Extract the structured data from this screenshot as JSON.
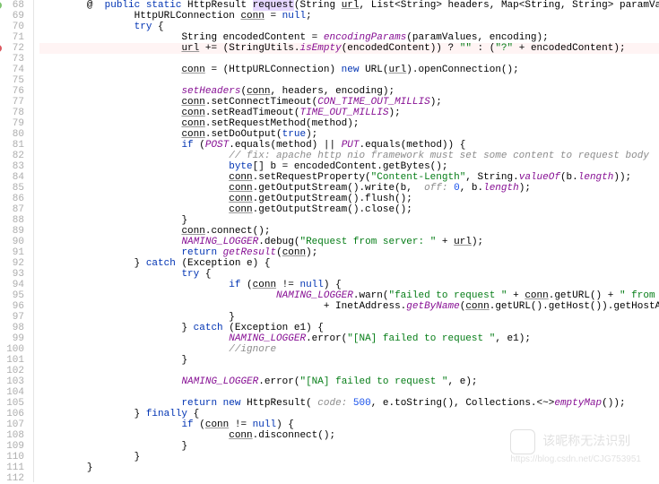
{
  "gutter": {
    "start": 68,
    "end": 112,
    "markers": {
      "68": "green",
      "72": "red"
    },
    "at_marker_line": 68
  },
  "code": {
    "lines": [
      {
        "n": 68,
        "indent": 2,
        "tokens": [
          {
            "t": "@  ",
            "c": ""
          },
          {
            "t": "public static ",
            "c": "kw"
          },
          {
            "t": "HttpResult ",
            "c": "type"
          },
          {
            "t": "request",
            "c": "hl-bg"
          },
          {
            "t": "(String ",
            "c": ""
          },
          {
            "t": "url",
            "c": "underline"
          },
          {
            "t": ", List<String> headers, Map<String, String> paramValues, String encoding, String method) {",
            "c": ""
          }
        ]
      },
      {
        "n": 69,
        "indent": 4,
        "tokens": [
          {
            "t": "HttpURLConnection ",
            "c": ""
          },
          {
            "t": "conn",
            "c": "underline"
          },
          {
            "t": " = ",
            "c": ""
          },
          {
            "t": "null",
            "c": "kw"
          },
          {
            "t": ";",
            "c": ""
          }
        ]
      },
      {
        "n": 70,
        "indent": 4,
        "tokens": [
          {
            "t": "try ",
            "c": "kw"
          },
          {
            "t": "{",
            "c": ""
          }
        ]
      },
      {
        "n": 71,
        "indent": 6,
        "tokens": [
          {
            "t": "String encodedContent = ",
            "c": ""
          },
          {
            "t": "encodingParams",
            "c": "field"
          },
          {
            "t": "(paramValues, encoding);",
            "c": ""
          }
        ]
      },
      {
        "n": 72,
        "indent": 6,
        "hl": true,
        "tokens": [
          {
            "t": "url",
            "c": "underline"
          },
          {
            "t": " += (StringUtils.",
            "c": ""
          },
          {
            "t": "isEmpty",
            "c": "field"
          },
          {
            "t": "(encodedContent)) ? ",
            "c": ""
          },
          {
            "t": "\"\"",
            "c": "str"
          },
          {
            "t": " : (",
            "c": ""
          },
          {
            "t": "\"?\"",
            "c": "str"
          },
          {
            "t": " + encodedContent);",
            "c": ""
          }
        ]
      },
      {
        "n": 73,
        "indent": 0,
        "tokens": []
      },
      {
        "n": 74,
        "indent": 6,
        "tokens": [
          {
            "t": "conn",
            "c": "underline"
          },
          {
            "t": " = (HttpURLConnection) ",
            "c": ""
          },
          {
            "t": "new ",
            "c": "kw"
          },
          {
            "t": "URL(",
            "c": ""
          },
          {
            "t": "url",
            "c": "underline"
          },
          {
            "t": ").openConnection();",
            "c": ""
          }
        ]
      },
      {
        "n": 75,
        "indent": 0,
        "tokens": []
      },
      {
        "n": 76,
        "indent": 6,
        "tokens": [
          {
            "t": "setHeaders",
            "c": "field"
          },
          {
            "t": "(",
            "c": ""
          },
          {
            "t": "conn",
            "c": "underline"
          },
          {
            "t": ", headers, encoding);",
            "c": ""
          }
        ]
      },
      {
        "n": 77,
        "indent": 6,
        "tokens": [
          {
            "t": "conn",
            "c": "underline"
          },
          {
            "t": ".setConnectTimeout(",
            "c": ""
          },
          {
            "t": "CON_TIME_OUT_MILLIS",
            "c": "const"
          },
          {
            "t": ");",
            "c": ""
          }
        ]
      },
      {
        "n": 78,
        "indent": 6,
        "tokens": [
          {
            "t": "conn",
            "c": "underline"
          },
          {
            "t": ".setReadTimeout(",
            "c": ""
          },
          {
            "t": "TIME_OUT_MILLIS",
            "c": "const"
          },
          {
            "t": ");",
            "c": ""
          }
        ]
      },
      {
        "n": 79,
        "indent": 6,
        "tokens": [
          {
            "t": "conn",
            "c": "underline"
          },
          {
            "t": ".setRequestMethod(method);",
            "c": ""
          }
        ]
      },
      {
        "n": 80,
        "indent": 6,
        "tokens": [
          {
            "t": "conn",
            "c": "underline"
          },
          {
            "t": ".setDoOutput(",
            "c": ""
          },
          {
            "t": "true",
            "c": "kw"
          },
          {
            "t": ");",
            "c": ""
          }
        ]
      },
      {
        "n": 81,
        "indent": 6,
        "tokens": [
          {
            "t": "if ",
            "c": "kw"
          },
          {
            "t": "(",
            "c": ""
          },
          {
            "t": "POST",
            "c": "const"
          },
          {
            "t": ".equals(method) || ",
            "c": ""
          },
          {
            "t": "PUT",
            "c": "const"
          },
          {
            "t": ".equals(method)) {",
            "c": ""
          }
        ]
      },
      {
        "n": 82,
        "indent": 8,
        "tokens": [
          {
            "t": "// fix: apache http nio framework must set some content to request body",
            "c": "com"
          }
        ]
      },
      {
        "n": 83,
        "indent": 8,
        "tokens": [
          {
            "t": "byte",
            "c": "kw"
          },
          {
            "t": "[] b = encodedContent.getBytes();",
            "c": ""
          }
        ]
      },
      {
        "n": 84,
        "indent": 8,
        "tokens": [
          {
            "t": "conn",
            "c": "underline"
          },
          {
            "t": ".setRequestProperty(",
            "c": ""
          },
          {
            "t": "\"Content-Length\"",
            "c": "str"
          },
          {
            "t": ", String.",
            "c": ""
          },
          {
            "t": "valueOf",
            "c": "field"
          },
          {
            "t": "(b.",
            "c": ""
          },
          {
            "t": "length",
            "c": "field"
          },
          {
            "t": "));",
            "c": ""
          }
        ]
      },
      {
        "n": 85,
        "indent": 8,
        "tokens": [
          {
            "t": "conn",
            "c": "underline"
          },
          {
            "t": ".getOutputStream().write(b,  ",
            "c": ""
          },
          {
            "t": "off: ",
            "c": "com"
          },
          {
            "t": "0",
            "c": "num"
          },
          {
            "t": ", b.",
            "c": ""
          },
          {
            "t": "length",
            "c": "field"
          },
          {
            "t": ");",
            "c": ""
          }
        ]
      },
      {
        "n": 86,
        "indent": 8,
        "tokens": [
          {
            "t": "conn",
            "c": "underline"
          },
          {
            "t": ".getOutputStream().flush();",
            "c": ""
          }
        ]
      },
      {
        "n": 87,
        "indent": 8,
        "tokens": [
          {
            "t": "conn",
            "c": "underline"
          },
          {
            "t": ".getOutputStream().close();",
            "c": ""
          }
        ]
      },
      {
        "n": 88,
        "indent": 6,
        "tokens": [
          {
            "t": "}",
            "c": ""
          }
        ]
      },
      {
        "n": 89,
        "indent": 6,
        "tokens": [
          {
            "t": "conn",
            "c": "underline"
          },
          {
            "t": ".connect();",
            "c": ""
          }
        ]
      },
      {
        "n": 90,
        "indent": 6,
        "tokens": [
          {
            "t": "NAMING_LOGGER",
            "c": "const"
          },
          {
            "t": ".debug(",
            "c": ""
          },
          {
            "t": "\"Request from server: \"",
            "c": "str"
          },
          {
            "t": " + ",
            "c": ""
          },
          {
            "t": "url",
            "c": "underline"
          },
          {
            "t": ");",
            "c": ""
          }
        ]
      },
      {
        "n": 91,
        "indent": 6,
        "tokens": [
          {
            "t": "return ",
            "c": "kw"
          },
          {
            "t": "getResult",
            "c": "field"
          },
          {
            "t": "(",
            "c": ""
          },
          {
            "t": "conn",
            "c": "underline"
          },
          {
            "t": ");",
            "c": ""
          }
        ]
      },
      {
        "n": 92,
        "indent": 4,
        "tokens": [
          {
            "t": "} ",
            "c": ""
          },
          {
            "t": "catch ",
            "c": "kw"
          },
          {
            "t": "(Exception e) {",
            "c": ""
          }
        ]
      },
      {
        "n": 93,
        "indent": 6,
        "tokens": [
          {
            "t": "try ",
            "c": "kw"
          },
          {
            "t": "{",
            "c": ""
          }
        ]
      },
      {
        "n": 94,
        "indent": 8,
        "tokens": [
          {
            "t": "if ",
            "c": "kw"
          },
          {
            "t": "(",
            "c": ""
          },
          {
            "t": "conn",
            "c": "underline"
          },
          {
            "t": " != ",
            "c": ""
          },
          {
            "t": "null",
            "c": "kw"
          },
          {
            "t": ") {",
            "c": ""
          }
        ]
      },
      {
        "n": 95,
        "indent": 10,
        "tokens": [
          {
            "t": "NAMING_LOGGER",
            "c": "const"
          },
          {
            "t": ".warn(",
            "c": ""
          },
          {
            "t": "\"failed to request \"",
            "c": "str"
          },
          {
            "t": " + ",
            "c": ""
          },
          {
            "t": "conn",
            "c": "underline"
          },
          {
            "t": ".getURL() + ",
            "c": ""
          },
          {
            "t": "\" from \"",
            "c": "str"
          }
        ]
      },
      {
        "n": 96,
        "indent": 12,
        "tokens": [
          {
            "t": "+ InetAddress.",
            "c": ""
          },
          {
            "t": "getByName",
            "c": "field"
          },
          {
            "t": "(",
            "c": ""
          },
          {
            "t": "conn",
            "c": "underline"
          },
          {
            "t": ".getURL().getHost()).getHostAddress());",
            "c": ""
          }
        ]
      },
      {
        "n": 97,
        "indent": 8,
        "tokens": [
          {
            "t": "}",
            "c": ""
          }
        ]
      },
      {
        "n": 98,
        "indent": 6,
        "tokens": [
          {
            "t": "} ",
            "c": ""
          },
          {
            "t": "catch ",
            "c": "kw"
          },
          {
            "t": "(Exception e1) {",
            "c": ""
          }
        ]
      },
      {
        "n": 99,
        "indent": 8,
        "tokens": [
          {
            "t": "NAMING_LOGGER",
            "c": "const"
          },
          {
            "t": ".error(",
            "c": ""
          },
          {
            "t": "\"[NA] failed to request \"",
            "c": "str"
          },
          {
            "t": ", e1);",
            "c": ""
          }
        ]
      },
      {
        "n": 100,
        "indent": 8,
        "tokens": [
          {
            "t": "//ignore",
            "c": "com"
          }
        ]
      },
      {
        "n": 101,
        "indent": 6,
        "tokens": [
          {
            "t": "}",
            "c": ""
          }
        ]
      },
      {
        "n": 102,
        "indent": 0,
        "tokens": []
      },
      {
        "n": 103,
        "indent": 6,
        "tokens": [
          {
            "t": "NAMING_LOGGER",
            "c": "const"
          },
          {
            "t": ".error(",
            "c": ""
          },
          {
            "t": "\"[NA] failed to request \"",
            "c": "str"
          },
          {
            "t": ", e);",
            "c": ""
          }
        ]
      },
      {
        "n": 104,
        "indent": 0,
        "tokens": []
      },
      {
        "n": 105,
        "indent": 6,
        "tokens": [
          {
            "t": "return new ",
            "c": "kw"
          },
          {
            "t": "HttpResult( ",
            "c": ""
          },
          {
            "t": "code: ",
            "c": "com"
          },
          {
            "t": "500",
            "c": "num"
          },
          {
            "t": ", e.toString(), Collections.<~>",
            "c": ""
          },
          {
            "t": "emptyMap",
            "c": "field"
          },
          {
            "t": "());",
            "c": ""
          }
        ]
      },
      {
        "n": 106,
        "indent": 4,
        "tokens": [
          {
            "t": "} ",
            "c": ""
          },
          {
            "t": "finally ",
            "c": "kw"
          },
          {
            "t": "{",
            "c": ""
          }
        ]
      },
      {
        "n": 107,
        "indent": 6,
        "tokens": [
          {
            "t": "if ",
            "c": "kw"
          },
          {
            "t": "(",
            "c": ""
          },
          {
            "t": "conn",
            "c": "underline"
          },
          {
            "t": " != ",
            "c": ""
          },
          {
            "t": "null",
            "c": "kw"
          },
          {
            "t": ") {",
            "c": ""
          }
        ]
      },
      {
        "n": 108,
        "indent": 8,
        "tokens": [
          {
            "t": "conn",
            "c": "underline"
          },
          {
            "t": ".disconnect();",
            "c": ""
          }
        ]
      },
      {
        "n": 109,
        "indent": 6,
        "tokens": [
          {
            "t": "}",
            "c": ""
          }
        ]
      },
      {
        "n": 110,
        "indent": 4,
        "tokens": [
          {
            "t": "}",
            "c": ""
          }
        ]
      },
      {
        "n": 111,
        "indent": 2,
        "tokens": [
          {
            "t": "}",
            "c": ""
          }
        ]
      },
      {
        "n": 112,
        "indent": 0,
        "tokens": []
      }
    ]
  },
  "watermark": {
    "text": "该昵称无法识别",
    "url": "https://blog.csdn.net/CJG753951"
  }
}
